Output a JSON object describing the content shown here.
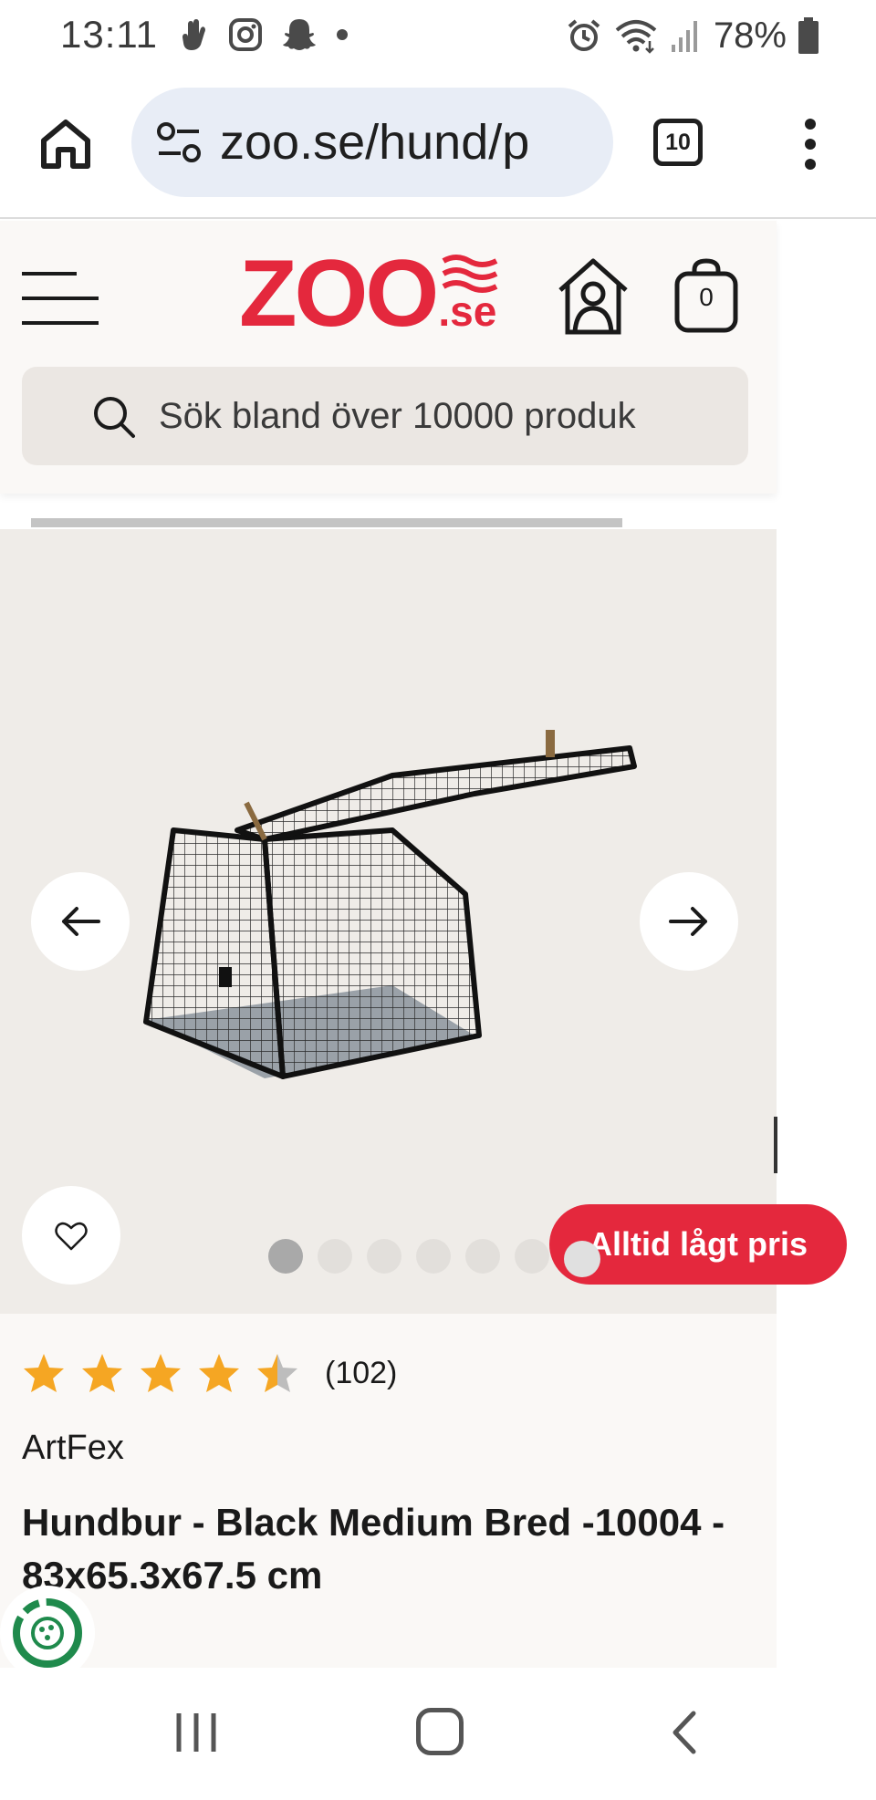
{
  "status_bar": {
    "time": "13:11",
    "battery_percent": "78%",
    "left_icons": [
      "hand-icon",
      "instagram-icon",
      "snapchat-icon",
      "dot-icon"
    ],
    "right_icons": [
      "alarm-icon",
      "wifi-icon",
      "signal-icon",
      "battery-icon"
    ]
  },
  "browser": {
    "url": "zoo.se/hund/p",
    "tab_count": "10"
  },
  "header": {
    "logo_text": "ZOO",
    "logo_suffix": ".se",
    "cart_count": "0",
    "search_placeholder": "Sök bland över 10000 produk"
  },
  "gallery": {
    "image_count": 7,
    "active_index": 0
  },
  "badge": {
    "label": "Alltid lågt pris"
  },
  "product": {
    "rating": 4.5,
    "review_count": "(102)",
    "brand": "ArtFex",
    "title": "Hundbur - Black Medium Bred -10004 - 83x65.3x67.5 cm"
  },
  "colors": {
    "brand_red": "#e4283d",
    "star_gold": "#f5a623",
    "gallery_bg": "#efece8",
    "header_bg": "#faf8f6"
  }
}
